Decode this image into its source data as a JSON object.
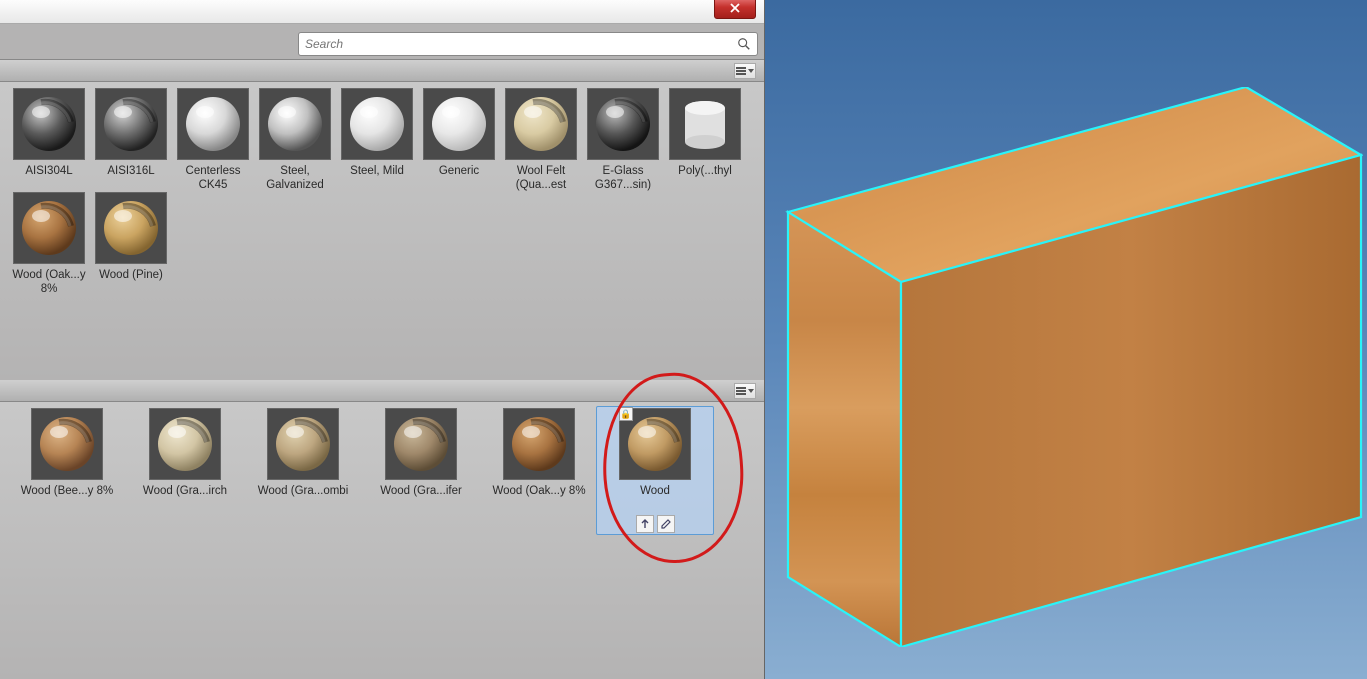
{
  "search": {
    "placeholder": "Search"
  },
  "top_materials": [
    {
      "label": "AISI304L",
      "type": "metal-dark"
    },
    {
      "label": "AISI316L",
      "type": "metal-gray"
    },
    {
      "label": "Centerless CK45",
      "type": "shiny-light"
    },
    {
      "label": "Steel, Galvanized",
      "type": "chrome"
    },
    {
      "label": "Steel, Mild",
      "type": "white-matte"
    },
    {
      "label": "Generic",
      "type": "white-plain"
    },
    {
      "label": "Wool Felt (Qua...est",
      "type": "felt"
    },
    {
      "label": "E-Glass G367...sin)",
      "type": "glass-dark"
    },
    {
      "label": "Poly(...thyl",
      "type": "cylinder"
    },
    {
      "label": "Wood (Oak...y 8%",
      "type": "wood-oak"
    },
    {
      "label": "Wood (Pine)",
      "type": "wood-pine"
    }
  ],
  "bottom_materials": [
    {
      "label": "Wood (Bee...y 8%",
      "type": "wood-beech"
    },
    {
      "label": "Wood (Gra...irch",
      "type": "wood-birch"
    },
    {
      "label": "Wood (Gra...ombi",
      "type": "wood-combi"
    },
    {
      "label": "Wood (Gra...ifer",
      "type": "wood-ifer"
    },
    {
      "label": "Wood (Oak...y 8%",
      "type": "wood-oak"
    },
    {
      "label": "Wood",
      "type": "wood-plain",
      "selected": true,
      "locked": true
    }
  ]
}
